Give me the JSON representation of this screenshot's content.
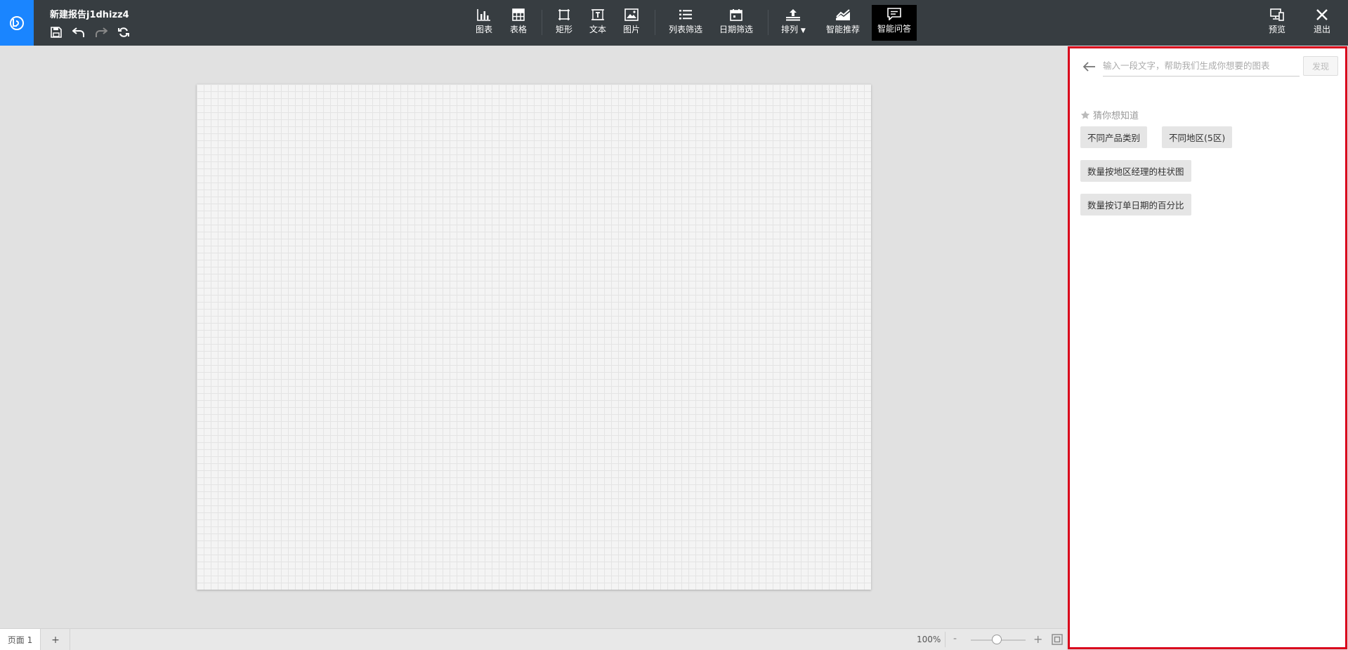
{
  "header": {
    "doc_title": "新建报告j1dhizz4",
    "logo_icon": "brand-logo-icon"
  },
  "quick_actions": {
    "save": "save-icon",
    "undo": "undo-icon",
    "redo": "redo-icon",
    "refresh": "refresh-icon"
  },
  "toolbar": {
    "chart": "图表",
    "table": "表格",
    "rect": "矩形",
    "text": "文本",
    "image": "图片",
    "list_filter": "列表筛选",
    "date_filter": "日期筛选",
    "arrange": "排列",
    "smart_recommend": "智能推荐",
    "smart_qa": "智能问答",
    "preview": "预览",
    "exit": "退出"
  },
  "bottom": {
    "page_tab": "页面 1",
    "add_page": "+",
    "zoom": "100%",
    "zoom_value": 1.0,
    "zoom_minus": "-",
    "zoom_plus": "+"
  },
  "qa_panel": {
    "input_placeholder": "输入一段文字，帮助我们生成你想要的图表",
    "input_value": "",
    "send": "发现",
    "guess_title": "猜你想知道",
    "suggestions": [
      "不同产品类别",
      "不同地区(5区)",
      "数量按地区经理的柱状图",
      "数量按订单日期的百分比"
    ]
  },
  "colors": {
    "topbar": "#373d41",
    "brand": "#1a85ff",
    "active_tool": "#000000",
    "panel_border": "#d9001b"
  }
}
